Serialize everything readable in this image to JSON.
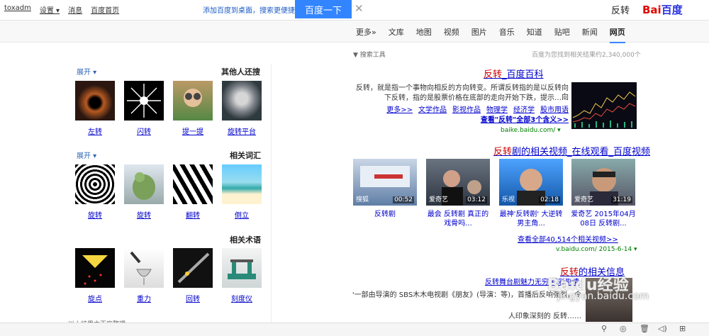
{
  "topbar": {
    "links": [
      "toxadm",
      "设置 ▾",
      "消息",
      "百度首页"
    ],
    "promo": "添加百度到桌面，搜索更便捷！",
    "search_button": "百度一下",
    "clear": "✕",
    "query": "反转",
    "logo_a": "Bai",
    "logo_b": "百度"
  },
  "tabs": {
    "items": [
      "网页",
      "新闻",
      "贴吧",
      "知道",
      "音乐",
      "图片",
      "视频",
      "地图",
      "文库",
      "更多»"
    ],
    "active": "网页"
  },
  "stats": "百度为您找到相关结果约2,340,000个",
  "tools": "▼ 搜索工具",
  "result1": {
    "title_em": "反转",
    "title_rest": "_百度百科",
    "desc1": "反转，就是指一个事物向相反的方向转变。所谓反转指的是以反转向向",
    "desc2": "下反转，指的是股票价格在底部的走向开始下跌，提示……",
    "links": [
      "股市用语",
      "经济学",
      "物理学",
      "影视作品",
      "文学作品",
      "更多>>"
    ],
    "more": "查看\"反转\"全部3个含义>>",
    "url": "baike.baidu.com/ ▾"
  },
  "result2": {
    "title_em": "反转",
    "title_rest": "剧的相关视频_在线观看_百度视频",
    "videos": [
      {
        "src": "爱奇艺",
        "dur": "31:19",
        "cap": "爱奇艺 2015年04月08日 反转剧..."
      },
      {
        "src": "乐视",
        "dur": "02:18",
        "cap": "最神'反转剧' 大逆转男主角..."
      },
      {
        "src": "爱奇艺",
        "dur": "03:12",
        "cap": "最会 反转剧 真正的戏骨吗..."
      },
      {
        "src": "搜狐",
        "dur": "00:52",
        "cap": "反转剧"
      }
    ],
    "more": "查看全部40,514个相关视频>>",
    "url": "v.baidu.com/ 2015-6-14 ▾"
  },
  "result3": {
    "title_em": "反转",
    "title_rest": "的相关信息",
    "subtitle": "反转舞台剧魅力无穷 精彩剧情",
    "desc1": "'一部由导演的 SBS木木电视剧《朋友》(导演：等)，首播后反响强烈，令",
    "desc2": "人印象深刻的 反转……"
  },
  "sidebar": {
    "sections": [
      {
        "title": "其他人还搜",
        "toggle": "展开 ▾",
        "items": [
          "旋转平台",
          "提一提",
          "闪转",
          "左转"
        ]
      },
      {
        "title": "相关词汇",
        "toggle": "展开 ▾",
        "items": [
          "倒立",
          "翻转",
          "旋转",
          "旋转"
        ]
      },
      {
        "title": "相关术语",
        "toggle": "",
        "items": [
          "刻度仪",
          "回转",
          "重力",
          "旋点"
        ]
      }
    ],
    "footer": "以上结果由百度整理"
  },
  "watermark": "Baidu经验",
  "watermark2": "jingyan.baidu.com",
  "statusbar": [
    "⊞",
    "◁)",
    "🗑",
    "◎",
    "⚲"
  ]
}
